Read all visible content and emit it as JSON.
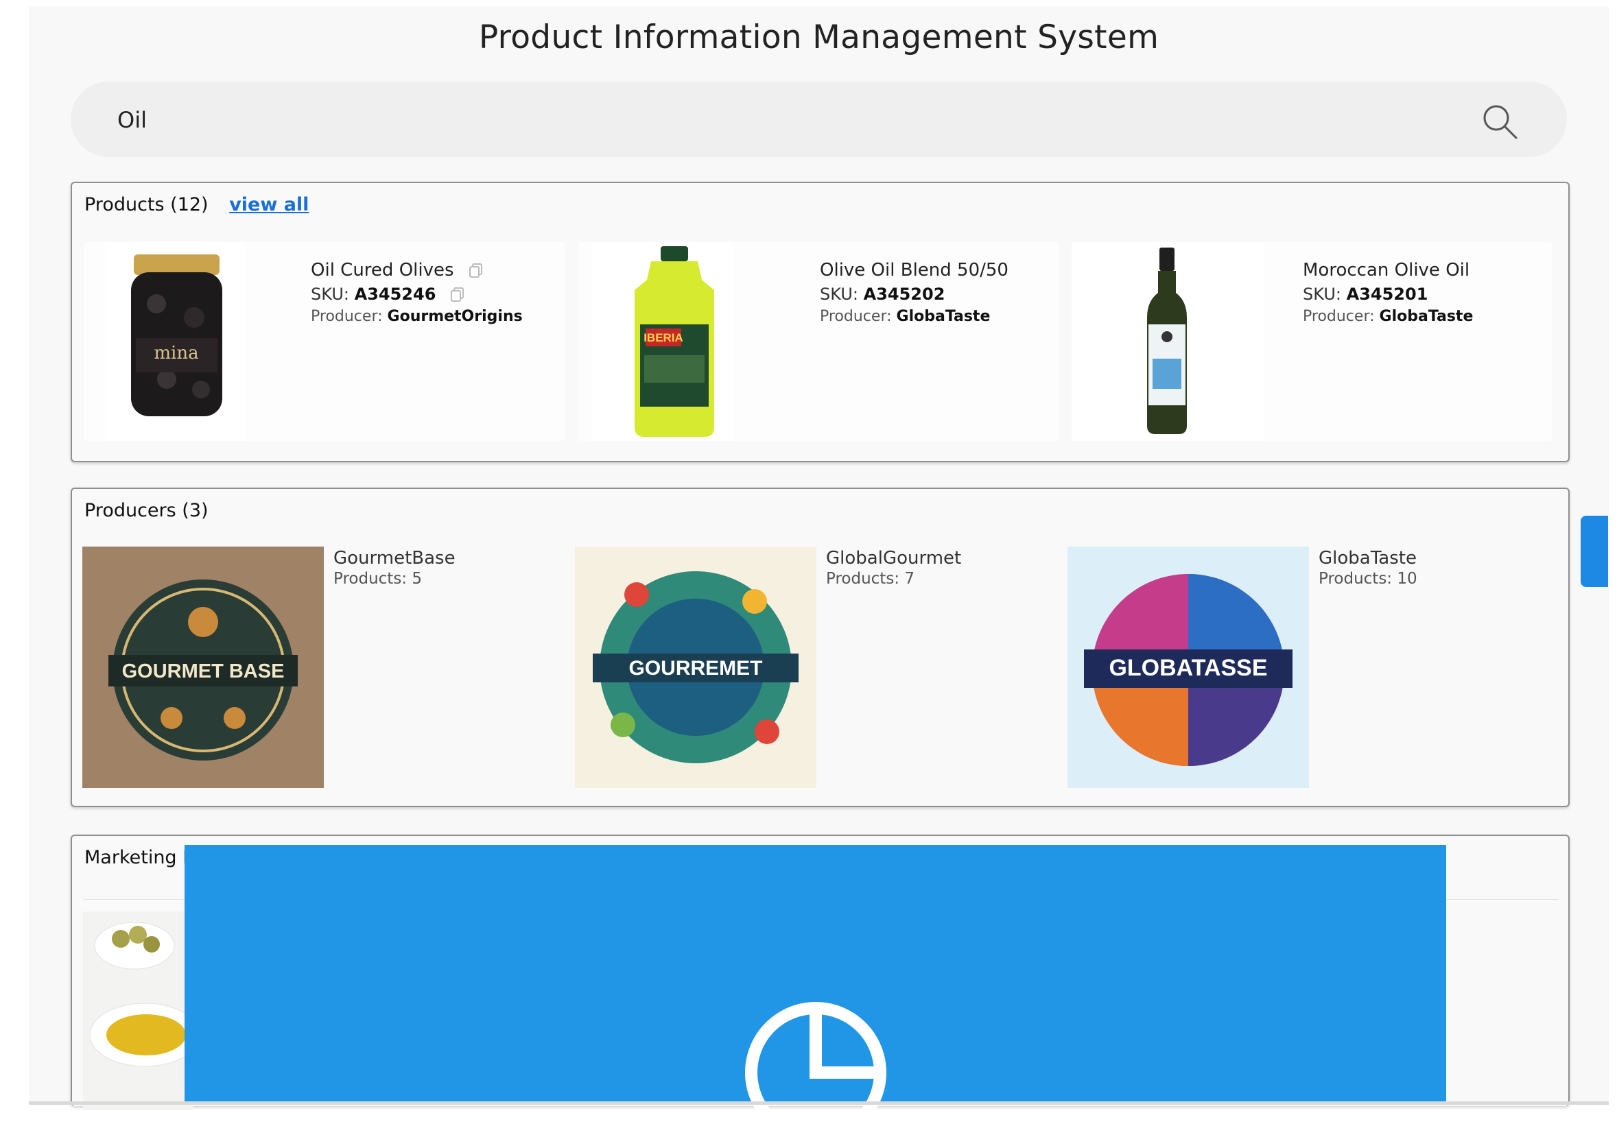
{
  "app": {
    "title": "Product Information Management System"
  },
  "search": {
    "value": "Oil",
    "placeholder": ""
  },
  "products": {
    "heading": "Products (12)",
    "view_all": "view all",
    "sku_label": "SKU:",
    "producer_label": "Producer:",
    "items": [
      {
        "name": "Oil Cured Olives",
        "sku": "A345246",
        "producer": "GourmetOrigins",
        "image_label": "mina"
      },
      {
        "name": "Olive Oil Blend 50/50",
        "sku": "A345202",
        "producer": "GlobaTaste",
        "image_label": "IBERIA"
      },
      {
        "name": "Moroccan Olive Oil",
        "sku": "A345201",
        "producer": "GlobaTaste",
        "image_label": ""
      }
    ]
  },
  "producers": {
    "heading": "Producers (3)",
    "items": [
      {
        "name": "GourmetBase",
        "count": "Products: 5",
        "logo_text": "GOURMET BASE"
      },
      {
        "name": "GlobalGourmet",
        "count": "Products: 7",
        "logo_text": "GOURREMET"
      },
      {
        "name": "GlobaTaste",
        "count": "Products: 10",
        "logo_text": "GLOBATASSE"
      }
    ]
  },
  "marketing": {
    "heading": "Marketing L"
  },
  "colors": {
    "accent": "#1a6fd6",
    "overlay": "#2196e6",
    "panel_border": "#8f8f8f"
  }
}
